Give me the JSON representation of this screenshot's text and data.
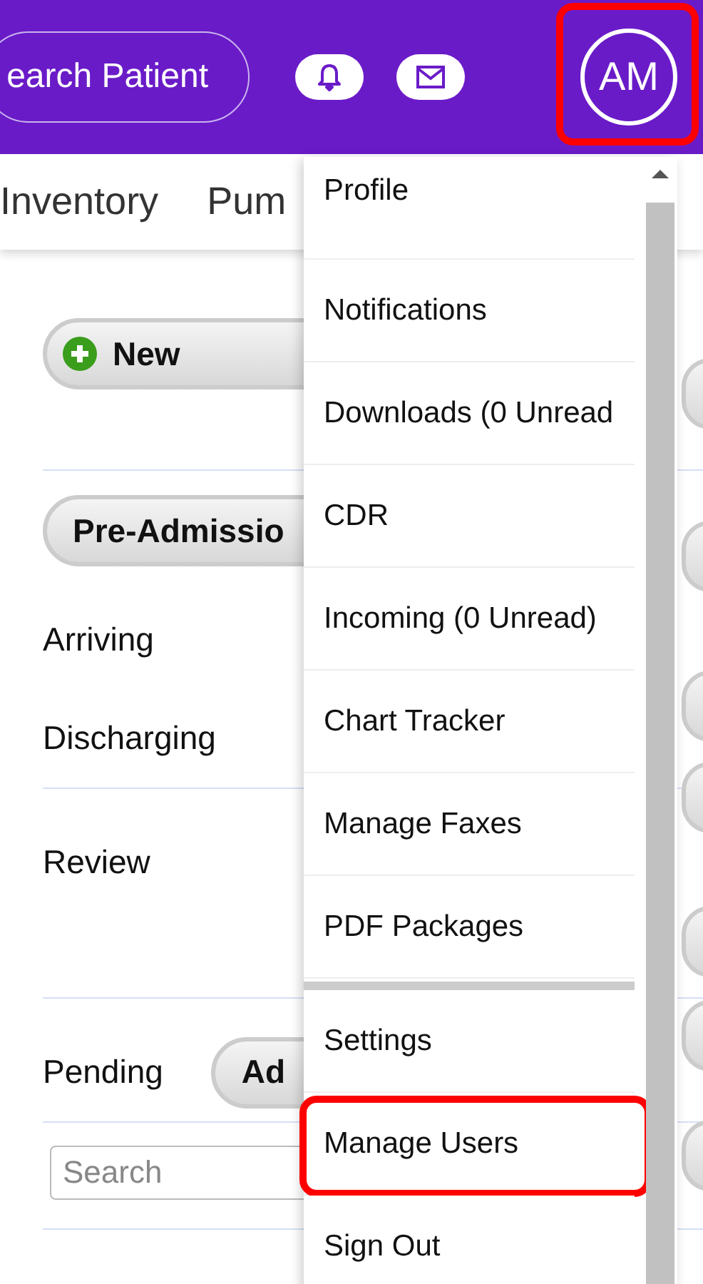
{
  "header": {
    "search_button": "earch Patient",
    "avatar": {
      "initials": "AM",
      "highlighted": true
    }
  },
  "tabs": [
    {
      "label": "Inventory",
      "selected": false
    },
    {
      "label": "Pum",
      "selected": false
    }
  ],
  "actions": {
    "new_button": "New"
  },
  "groups": [
    {
      "button": "Pre-Admissio",
      "rows": [
        {
          "label": "Arriving"
        },
        {
          "label": "Discharging"
        }
      ]
    },
    {
      "rows": [
        {
          "label": "Review"
        }
      ]
    },
    {
      "rows": [
        {
          "label": "Pending",
          "button": "Ad"
        }
      ]
    }
  ],
  "search": {
    "placeholder": "Search"
  },
  "menu": {
    "sections": [
      {
        "items": [
          {
            "label": "Profile",
            "highlighted": false
          },
          {
            "label": "Notifications",
            "highlighted": false
          },
          {
            "label": "Downloads (0 Unread",
            "highlighted": false
          },
          {
            "label": "CDR",
            "highlighted": false
          },
          {
            "label": "Incoming (0 Unread)",
            "highlighted": false
          },
          {
            "label": "Chart Tracker",
            "highlighted": false
          },
          {
            "label": "Manage Faxes",
            "highlighted": false
          },
          {
            "label": "PDF Packages",
            "highlighted": false
          }
        ]
      },
      {
        "items": [
          {
            "label": "Settings",
            "highlighted": false
          },
          {
            "label": "Manage Users",
            "highlighted": true
          },
          {
            "label": "Sign Out",
            "highlighted": false
          }
        ]
      }
    ]
  }
}
